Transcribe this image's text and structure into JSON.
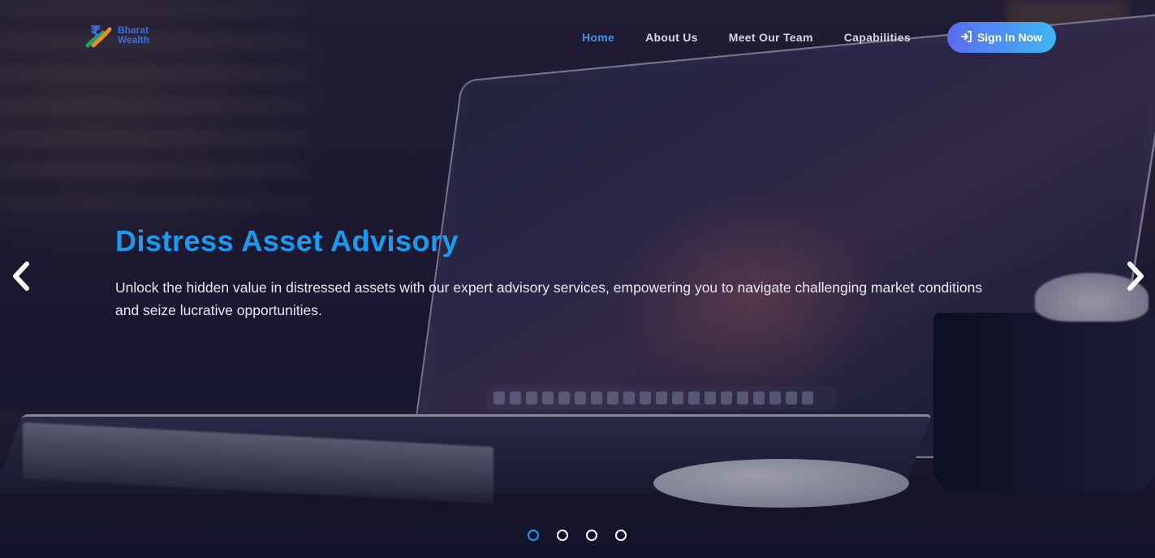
{
  "brand": {
    "line1": "Bharat",
    "line2": "Wealth",
    "logo_icon": "rupee-logo-icon"
  },
  "nav": {
    "items": [
      {
        "label": "Home",
        "active": true
      },
      {
        "label": "About Us",
        "active": false
      },
      {
        "label": "Meet Our Team",
        "active": false
      },
      {
        "label": "Capabilities",
        "active": false
      }
    ],
    "signin": {
      "label": "Sign In Now",
      "icon": "sign-in-icon"
    }
  },
  "hero": {
    "title": "Distress Asset Advisory",
    "description": "Unlock the hidden value in distressed assets with our expert advisory services, empowering you to navigate challenging market conditions and seize lucrative opportunities."
  },
  "carousel": {
    "prev_icon": "chevron-left-icon",
    "next_icon": "chevron-right-icon",
    "slides": 4,
    "active_slide": 1
  },
  "colors": {
    "accent": "#1a9bf0",
    "nav_active": "#4a90e2",
    "button_start": "#5a6cf0",
    "button_end": "#3fb7f2"
  }
}
